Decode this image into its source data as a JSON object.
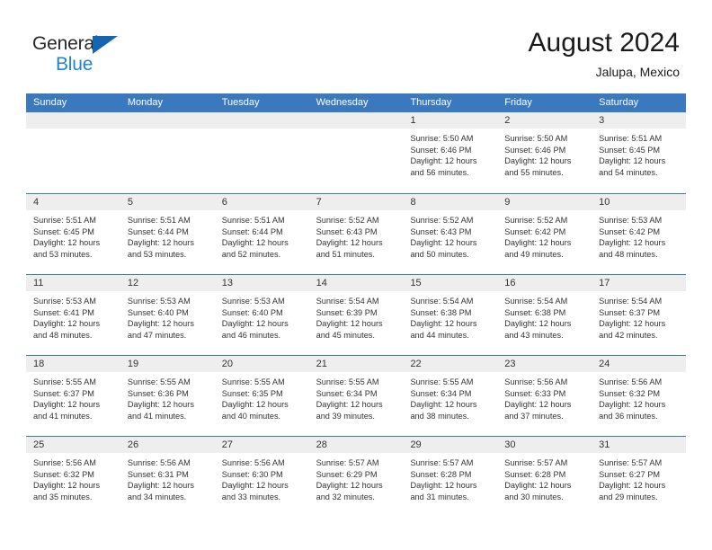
{
  "logo": {
    "word_one": "General",
    "word_two": "Blue",
    "triangle_color": "#1565b0",
    "blue_color": "#1f84d6"
  },
  "header": {
    "title": "August 2024",
    "subtitle": "Jalupa, Mexico"
  },
  "theme": {
    "header_blue": "#3a78bf",
    "date_band_gray": "#eeeeee",
    "text_color": "#333333"
  },
  "day_names": [
    "Sunday",
    "Monday",
    "Tuesday",
    "Wednesday",
    "Thursday",
    "Friday",
    "Saturday"
  ],
  "weeks": [
    [
      {
        "empty": true
      },
      {
        "empty": true
      },
      {
        "empty": true
      },
      {
        "empty": true
      },
      {
        "date": "1",
        "sunrise": "Sunrise: 5:50 AM",
        "sunset": "Sunset: 6:46 PM",
        "daylight_1": "Daylight: 12 hours",
        "daylight_2": "and 56 minutes."
      },
      {
        "date": "2",
        "sunrise": "Sunrise: 5:50 AM",
        "sunset": "Sunset: 6:46 PM",
        "daylight_1": "Daylight: 12 hours",
        "daylight_2": "and 55 minutes."
      },
      {
        "date": "3",
        "sunrise": "Sunrise: 5:51 AM",
        "sunset": "Sunset: 6:45 PM",
        "daylight_1": "Daylight: 12 hours",
        "daylight_2": "and 54 minutes."
      }
    ],
    [
      {
        "date": "4",
        "sunrise": "Sunrise: 5:51 AM",
        "sunset": "Sunset: 6:45 PM",
        "daylight_1": "Daylight: 12 hours",
        "daylight_2": "and 53 minutes."
      },
      {
        "date": "5",
        "sunrise": "Sunrise: 5:51 AM",
        "sunset": "Sunset: 6:44 PM",
        "daylight_1": "Daylight: 12 hours",
        "daylight_2": "and 53 minutes."
      },
      {
        "date": "6",
        "sunrise": "Sunrise: 5:51 AM",
        "sunset": "Sunset: 6:44 PM",
        "daylight_1": "Daylight: 12 hours",
        "daylight_2": "and 52 minutes."
      },
      {
        "date": "7",
        "sunrise": "Sunrise: 5:52 AM",
        "sunset": "Sunset: 6:43 PM",
        "daylight_1": "Daylight: 12 hours",
        "daylight_2": "and 51 minutes."
      },
      {
        "date": "8",
        "sunrise": "Sunrise: 5:52 AM",
        "sunset": "Sunset: 6:43 PM",
        "daylight_1": "Daylight: 12 hours",
        "daylight_2": "and 50 minutes."
      },
      {
        "date": "9",
        "sunrise": "Sunrise: 5:52 AM",
        "sunset": "Sunset: 6:42 PM",
        "daylight_1": "Daylight: 12 hours",
        "daylight_2": "and 49 minutes."
      },
      {
        "date": "10",
        "sunrise": "Sunrise: 5:53 AM",
        "sunset": "Sunset: 6:42 PM",
        "daylight_1": "Daylight: 12 hours",
        "daylight_2": "and 48 minutes."
      }
    ],
    [
      {
        "date": "11",
        "sunrise": "Sunrise: 5:53 AM",
        "sunset": "Sunset: 6:41 PM",
        "daylight_1": "Daylight: 12 hours",
        "daylight_2": "and 48 minutes."
      },
      {
        "date": "12",
        "sunrise": "Sunrise: 5:53 AM",
        "sunset": "Sunset: 6:40 PM",
        "daylight_1": "Daylight: 12 hours",
        "daylight_2": "and 47 minutes."
      },
      {
        "date": "13",
        "sunrise": "Sunrise: 5:53 AM",
        "sunset": "Sunset: 6:40 PM",
        "daylight_1": "Daylight: 12 hours",
        "daylight_2": "and 46 minutes."
      },
      {
        "date": "14",
        "sunrise": "Sunrise: 5:54 AM",
        "sunset": "Sunset: 6:39 PM",
        "daylight_1": "Daylight: 12 hours",
        "daylight_2": "and 45 minutes."
      },
      {
        "date": "15",
        "sunrise": "Sunrise: 5:54 AM",
        "sunset": "Sunset: 6:38 PM",
        "daylight_1": "Daylight: 12 hours",
        "daylight_2": "and 44 minutes."
      },
      {
        "date": "16",
        "sunrise": "Sunrise: 5:54 AM",
        "sunset": "Sunset: 6:38 PM",
        "daylight_1": "Daylight: 12 hours",
        "daylight_2": "and 43 minutes."
      },
      {
        "date": "17",
        "sunrise": "Sunrise: 5:54 AM",
        "sunset": "Sunset: 6:37 PM",
        "daylight_1": "Daylight: 12 hours",
        "daylight_2": "and 42 minutes."
      }
    ],
    [
      {
        "date": "18",
        "sunrise": "Sunrise: 5:55 AM",
        "sunset": "Sunset: 6:37 PM",
        "daylight_1": "Daylight: 12 hours",
        "daylight_2": "and 41 minutes."
      },
      {
        "date": "19",
        "sunrise": "Sunrise: 5:55 AM",
        "sunset": "Sunset: 6:36 PM",
        "daylight_1": "Daylight: 12 hours",
        "daylight_2": "and 41 minutes."
      },
      {
        "date": "20",
        "sunrise": "Sunrise: 5:55 AM",
        "sunset": "Sunset: 6:35 PM",
        "daylight_1": "Daylight: 12 hours",
        "daylight_2": "and 40 minutes."
      },
      {
        "date": "21",
        "sunrise": "Sunrise: 5:55 AM",
        "sunset": "Sunset: 6:34 PM",
        "daylight_1": "Daylight: 12 hours",
        "daylight_2": "and 39 minutes."
      },
      {
        "date": "22",
        "sunrise": "Sunrise: 5:55 AM",
        "sunset": "Sunset: 6:34 PM",
        "daylight_1": "Daylight: 12 hours",
        "daylight_2": "and 38 minutes."
      },
      {
        "date": "23",
        "sunrise": "Sunrise: 5:56 AM",
        "sunset": "Sunset: 6:33 PM",
        "daylight_1": "Daylight: 12 hours",
        "daylight_2": "and 37 minutes."
      },
      {
        "date": "24",
        "sunrise": "Sunrise: 5:56 AM",
        "sunset": "Sunset: 6:32 PM",
        "daylight_1": "Daylight: 12 hours",
        "daylight_2": "and 36 minutes."
      }
    ],
    [
      {
        "date": "25",
        "sunrise": "Sunrise: 5:56 AM",
        "sunset": "Sunset: 6:32 PM",
        "daylight_1": "Daylight: 12 hours",
        "daylight_2": "and 35 minutes."
      },
      {
        "date": "26",
        "sunrise": "Sunrise: 5:56 AM",
        "sunset": "Sunset: 6:31 PM",
        "daylight_1": "Daylight: 12 hours",
        "daylight_2": "and 34 minutes."
      },
      {
        "date": "27",
        "sunrise": "Sunrise: 5:56 AM",
        "sunset": "Sunset: 6:30 PM",
        "daylight_1": "Daylight: 12 hours",
        "daylight_2": "and 33 minutes."
      },
      {
        "date": "28",
        "sunrise": "Sunrise: 5:57 AM",
        "sunset": "Sunset: 6:29 PM",
        "daylight_1": "Daylight: 12 hours",
        "daylight_2": "and 32 minutes."
      },
      {
        "date": "29",
        "sunrise": "Sunrise: 5:57 AM",
        "sunset": "Sunset: 6:28 PM",
        "daylight_1": "Daylight: 12 hours",
        "daylight_2": "and 31 minutes."
      },
      {
        "date": "30",
        "sunrise": "Sunrise: 5:57 AM",
        "sunset": "Sunset: 6:28 PM",
        "daylight_1": "Daylight: 12 hours",
        "daylight_2": "and 30 minutes."
      },
      {
        "date": "31",
        "sunrise": "Sunrise: 5:57 AM",
        "sunset": "Sunset: 6:27 PM",
        "daylight_1": "Daylight: 12 hours",
        "daylight_2": "and 29 minutes."
      }
    ]
  ]
}
